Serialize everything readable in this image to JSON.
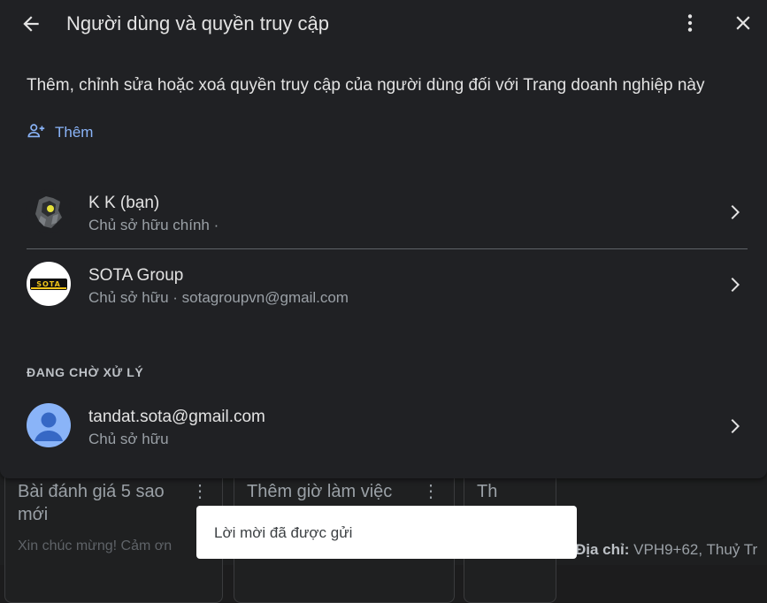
{
  "header": {
    "title": "Người dùng và quyền truy cập"
  },
  "description": "Thêm, chỉnh sửa hoặc xoá quyền truy cập của người dùng đối với Trang doanh nghiệp này",
  "add_button": {
    "label": "Thêm"
  },
  "users": [
    {
      "name": "K K (bạn)",
      "role": "Chủ sở hữu chính ·",
      "avatar": "robot-avatar"
    },
    {
      "name": "SOTA Group",
      "role": "Chủ sở hữu · sotagroupvn@gmail.com",
      "avatar": "sota-logo",
      "logo_text": "SOTA"
    }
  ],
  "pending": {
    "section_title": "ĐANG CHỜ XỬ LÝ",
    "users": [
      {
        "name": "tandat.sota@gmail.com",
        "role": "Chủ sở hữu",
        "avatar": "default-person-avatar"
      }
    ]
  },
  "background": {
    "cards": [
      {
        "title": "Bài đánh giá 5 sao mới",
        "subtitle": "Xin chúc mừng! Cảm ơn"
      },
      {
        "title": "Thêm giờ làm việc"
      },
      {
        "title": "Th"
      }
    ],
    "address_label": "Địa chỉ:",
    "address_value": "VPH9+62, Thuỷ Tr"
  },
  "toast": {
    "message": "Lời mời đã được gửi"
  },
  "colors": {
    "accent": "#8ab4f8",
    "panel": "#202124",
    "avatar_blue": "#8ab4f8"
  }
}
